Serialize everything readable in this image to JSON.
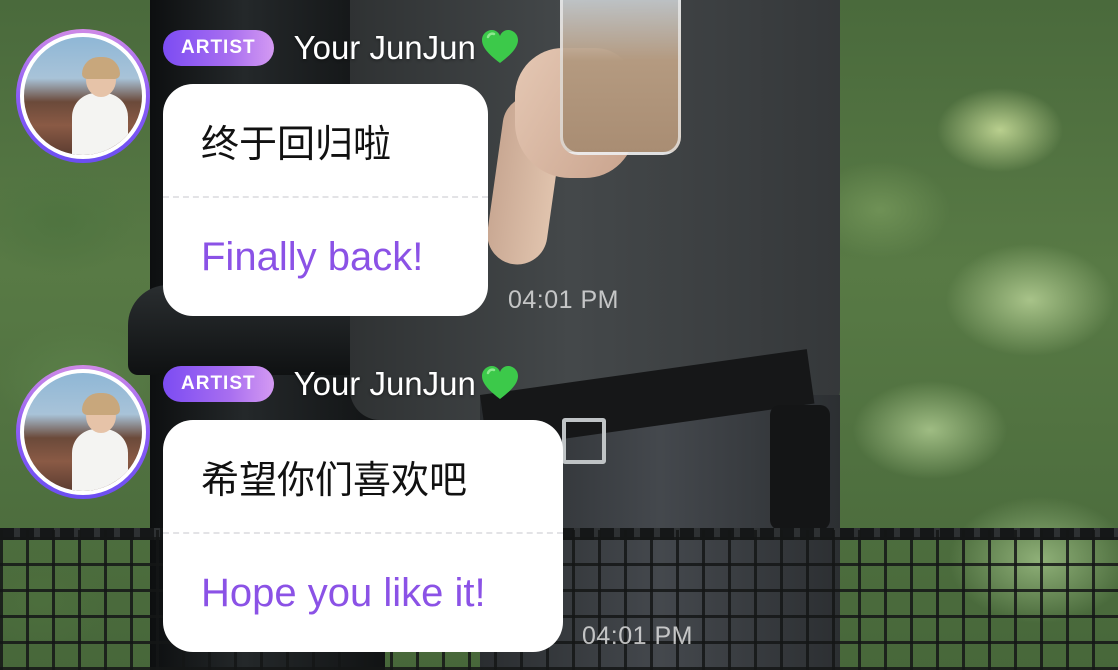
{
  "messages": [
    {
      "badge": "ARTIST",
      "sender": "Your JunJun",
      "heart_icon": "green-heart-icon",
      "original_text": "终于回归啦",
      "translated_text": "Finally back!",
      "time": "04:01 PM"
    },
    {
      "badge": "ARTIST",
      "sender": "Your JunJun",
      "heart_icon": "green-heart-icon",
      "original_text": "希望你们喜欢吧",
      "translated_text": "Hope you like it!",
      "time": "04:01 PM"
    }
  ],
  "colors": {
    "badge_gradient_start": "#7c4cf3",
    "badge_gradient_end": "#d49af2",
    "translation_text": "#8b52e6",
    "heart": "#3cc94a",
    "avatar_ring": "#8b5cf6"
  }
}
